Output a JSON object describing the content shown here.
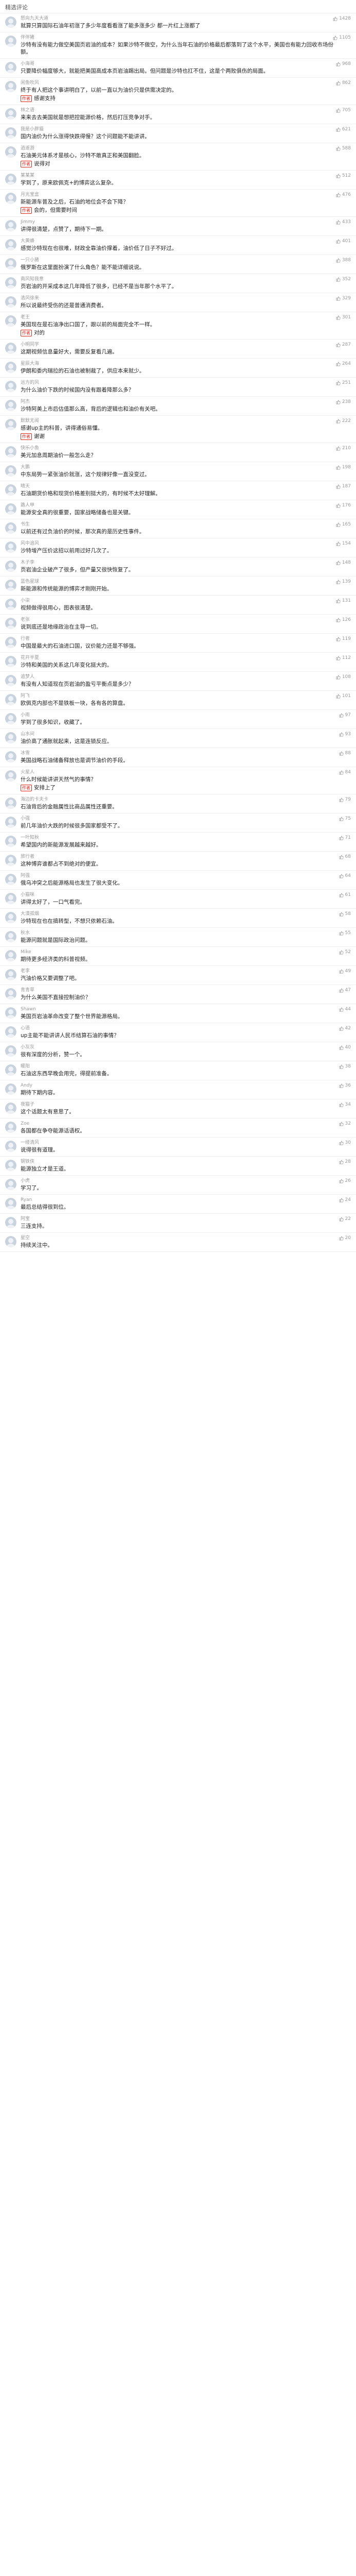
{
  "header": {
    "title": "精选评论"
  },
  "comments": [
    {
      "user": "怒向九天大道",
      "likes": "1428",
      "text": "就算只算国际石油年初涨了多少年度看看涨了能多涨多少 都一片红上涨都了",
      "author": null
    },
    {
      "user": "伴伴猪",
      "likes": "1105",
      "text": "沙特有没有能力做空美国页岩油的成本？如果沙特不做空，为什么当年石油的价格最后都落到了这个水平，美国也有能力回收市场份额。",
      "author": null
    },
    {
      "user": "小海哥",
      "likes": "968",
      "text": "只要降价幅度够大，就能把美国高成本页岩油踢出局。但问题是沙特也扛不住，这是个两败俱伤的局面。",
      "author": null
    },
    {
      "user": "闲鱼吹风",
      "likes": "862",
      "text": "终于有人把这个事讲明白了，以前一直以为油价只是供需决定的。",
      "author": "感谢支持"
    },
    {
      "user": "林之语",
      "likes": "705",
      "text": "来来去去美国就是想把控能源价格，然后打压竞争对手。",
      "author": null
    },
    {
      "user": "我是小胖猫",
      "likes": "621",
      "text": "国内油价为什么涨得快跌得慢？这个问题能不能讲讲。",
      "author": null
    },
    {
      "user": "逍遥游",
      "likes": "588",
      "text": "石油美元体系才是核心，沙特不敢真正和美国翻脸。",
      "author": "说得对"
    },
    {
      "user": "某某某",
      "likes": "512",
      "text": "学到了，原来欧佩克+的博弈这么复杂。",
      "author": null
    },
    {
      "user": "月光宝盒",
      "likes": "476",
      "text": "新能源车普及之后，石油的地位会不会下降？",
      "author": "会的，但需要时间"
    },
    {
      "user": "Jimmy",
      "likes": "433",
      "text": "讲得很清楚，点赞了，期待下一期。",
      "author": null
    },
    {
      "user": "大黄蜂",
      "likes": "401",
      "text": "感觉沙特现在也很难，财政全靠油价撑着，油价低了日子不好过。",
      "author": null
    },
    {
      "user": "一只小猪",
      "likes": "388",
      "text": "俄罗斯在这里面扮演了什么角色？能不能详细说说。",
      "author": null
    },
    {
      "user": "南风知我意",
      "likes": "352",
      "text": "页岩油的开采成本这几年降低了很多，已经不是当年那个水平了。",
      "author": null
    },
    {
      "user": "清风徐来",
      "likes": "329",
      "text": "所以说最终受伤的还是普通消费者。",
      "author": null
    },
    {
      "user": "老王",
      "likes": "301",
      "text": "美国现在是石油净出口国了，跟以前的局面完全不一样。",
      "author": "对的"
    },
    {
      "user": "小明同学",
      "likes": "287",
      "text": "这期视频信息量好大，需要反复看几遍。",
      "author": null
    },
    {
      "user": "星辰大海",
      "likes": "264",
      "text": "伊朗和委内瑞拉的石油也被制裁了，供应本来就少。",
      "author": null
    },
    {
      "user": "远方的风",
      "likes": "251",
      "text": "为什么油价下跌的时候国内没有跟着降那么多？",
      "author": null
    },
    {
      "user": "阿杰",
      "likes": "238",
      "text": "沙特阿美上市后估值那么高，背后的逻辑也和油价有关吧。",
      "author": null
    },
    {
      "user": "默默无闻",
      "likes": "222",
      "text": "感谢up主的科普，讲得通俗易懂。",
      "author": "谢谢"
    },
    {
      "user": "快乐小鱼",
      "likes": "210",
      "text": "美元加息周期油价一般怎么走？",
      "author": null
    },
    {
      "user": "大鹏",
      "likes": "198",
      "text": "中东局势一紧张油价就涨，这个规律好像一直没变过。",
      "author": null
    },
    {
      "user": "晴天",
      "likes": "187",
      "text": "石油期货价格和现货价格差别挺大的，有时候不太好理解。",
      "author": null
    },
    {
      "user": "路人甲",
      "likes": "176",
      "text": "能源安全真的很重要，国家战略储备也是关键。",
      "author": null
    },
    {
      "user": "书生",
      "likes": "165",
      "text": "以前还有过负油价的时候，那次真的是历史性事件。",
      "author": null
    },
    {
      "user": "风中追风",
      "likes": "154",
      "text": "沙特增产压价这招以前用过好几次了。",
      "author": null
    },
    {
      "user": "木子李",
      "likes": "148",
      "text": "页岩油企业破产了很多，但产量又很快恢复了。",
      "author": null
    },
    {
      "user": "蓝色星球",
      "likes": "139",
      "text": "新能源和传统能源的博弈才刚刚开始。",
      "author": null
    },
    {
      "user": "小柒",
      "likes": "131",
      "text": "视频做得很用心，图表很清楚。",
      "author": null
    },
    {
      "user": "老张",
      "likes": "126",
      "text": "说到底还是地缘政治在主导一切。",
      "author": null
    },
    {
      "user": "行者",
      "likes": "119",
      "text": "中国是最大的石油进口国，议价能力还是不够强。",
      "author": null
    },
    {
      "user": "花开半夏",
      "likes": "112",
      "text": "沙特和美国的关系这几年变化挺大的。",
      "author": null
    },
    {
      "user": "追梦人",
      "likes": "108",
      "text": "有没有人知道现在页岩油的盈亏平衡点是多少？",
      "author": null
    },
    {
      "user": "阿飞",
      "likes": "101",
      "text": "欧佩克内部也不是铁板一块，各有各的算盘。",
      "author": null
    },
    {
      "user": "小雨",
      "likes": "97",
      "text": "学到了很多知识，收藏了。",
      "author": null
    },
    {
      "user": "山水间",
      "likes": "93",
      "text": "油价高了通胀就起来，这是连锁反应。",
      "author": null
    },
    {
      "user": "冰雪",
      "likes": "88",
      "text": "美国战略石油储备释放也是调节油价的手段。",
      "author": null
    },
    {
      "user": "火星人",
      "likes": "84",
      "text": "什么时候能讲讲天然气的事情？",
      "author": "安排上了"
    },
    {
      "user": "海边的卡夫卡",
      "likes": "79",
      "text": "石油背后的金融属性比商品属性还重要。",
      "author": null
    },
    {
      "user": "小强",
      "likes": "75",
      "text": "前几年油价大跌的时候很多国家都受不了。",
      "author": null
    },
    {
      "user": "一叶知秋",
      "likes": "71",
      "text": "希望国内的新能源发展越来越好。",
      "author": null
    },
    {
      "user": "旅行者",
      "likes": "68",
      "text": "这种博弈谁都占不到绝对的便宜。",
      "author": null
    },
    {
      "user": "阿强",
      "likes": "64",
      "text": "俄乌冲突之后能源格局也发生了很大变化。",
      "author": null
    },
    {
      "user": "小猫咪",
      "likes": "61",
      "text": "讲得太好了，一口气看完。",
      "author": null
    },
    {
      "user": "大漠孤烟",
      "likes": "58",
      "text": "沙特现在也在搞转型，不想只依赖石油。",
      "author": null
    },
    {
      "user": "秋水",
      "likes": "55",
      "text": "能源问题就是国际政治问题。",
      "author": null
    },
    {
      "user": "Mike",
      "likes": "52",
      "text": "期待更多经济类的科普视频。",
      "author": null
    },
    {
      "user": "老李",
      "likes": "49",
      "text": "汽油价格又要调整了吧。",
      "author": null
    },
    {
      "user": "青青草",
      "likes": "47",
      "text": "为什么美国不直接控制油价？",
      "author": null
    },
    {
      "user": "Shawn",
      "likes": "44",
      "text": "美国页岩油革命改变了整个世界能源格局。",
      "author": null
    },
    {
      "user": "心语",
      "likes": "42",
      "text": "up主能不能讲讲人民币结算石油的事情？",
      "author": null
    },
    {
      "user": "小灰灰",
      "likes": "40",
      "text": "很有深度的分析，赞一个。",
      "author": null
    },
    {
      "user": "暖阳",
      "likes": "38",
      "text": "石油这东西早晚会用完，得提前准备。",
      "author": null
    },
    {
      "user": "Andy",
      "likes": "36",
      "text": "期待下期内容。",
      "author": null
    },
    {
      "user": "夜猫子",
      "likes": "34",
      "text": "这个话题太有意思了。",
      "author": null
    },
    {
      "user": "Zoe",
      "likes": "32",
      "text": "各国都在争夺能源话语权。",
      "author": null
    },
    {
      "user": "一缕清风",
      "likes": "30",
      "text": "说得很有道理。",
      "author": null
    },
    {
      "user": "钢铁侠",
      "likes": "28",
      "text": "能源独立才是王道。",
      "author": null
    },
    {
      "user": "小虎",
      "likes": "26",
      "text": "学习了。",
      "author": null
    },
    {
      "user": "Ryan",
      "likes": "24",
      "text": "最后总结得很到位。",
      "author": null
    },
    {
      "user": "阿宝",
      "likes": "22",
      "text": "三连支持。",
      "author": null
    },
    {
      "user": "星空",
      "likes": "20",
      "text": "持续关注中。",
      "author": null
    }
  ]
}
